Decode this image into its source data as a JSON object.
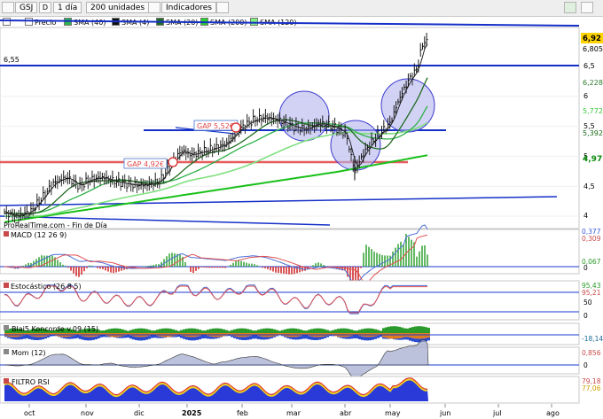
{
  "toolbar": {
    "symbol": "GSJ",
    "interval": "1 día",
    "units": "200 unidades",
    "indicators": "Indicadores"
  },
  "legend": {
    "price": "Precio",
    "items": [
      {
        "label": "SMA (40)",
        "color": "#2db34a"
      },
      {
        "label": "SMA (4)",
        "color": "#111111"
      },
      {
        "label": "SMA (20)",
        "color": "#1f6b1f"
      },
      {
        "label": "SMA (200)",
        "color": "#27d127"
      },
      {
        "label": "SMA (120)",
        "color": "#7ef07e"
      }
    ]
  },
  "main": {
    "level_label": "6,55",
    "source": "ProRealTime.com - Fin de Día",
    "gap_labels": [
      "GAP 4,92€",
      "GAP 5,52€"
    ],
    "y_ticks": [
      "6,5",
      "6",
      "5,5",
      "5",
      "4,5",
      "4"
    ],
    "price_badges": [
      {
        "text": "6,92",
        "bg": "#ffd400",
        "fg": "#000000"
      },
      {
        "text": "6,805",
        "bg": "#ffffff",
        "fg": "#000000"
      },
      {
        "text": "6,228",
        "bg": "#ffffff",
        "fg": "#2a7a2a"
      },
      {
        "text": "5,772",
        "bg": "#ffffff",
        "fg": "#37c837"
      },
      {
        "text": "5,392",
        "bg": "#ffffff",
        "fg": "#1a6a1a"
      },
      {
        "text": "4,97",
        "bg": "#ffffff",
        "fg": "#0b8a0b"
      }
    ]
  },
  "panels": {
    "macd": {
      "label": "MACD (12 26 9)",
      "values": [
        "0,377",
        "0,309",
        "0,067"
      ],
      "zero": "0"
    },
    "stoch": {
      "label": "Estocástico (26 8 5)",
      "values": [
        "95,43",
        "95,21"
      ],
      "ticks": [
        "50",
        "0"
      ]
    },
    "blai5": {
      "label": "Blai5 Koncorde v.09 (15)",
      "values": [
        "-18,14"
      ]
    },
    "mom": {
      "label": "Mom (12)",
      "values": [
        "0,856"
      ],
      "zero": "0"
    },
    "rsi": {
      "label": "FILTRO RSI",
      "values": [
        "79,18",
        "77,06"
      ]
    }
  },
  "x_axis": {
    "months": [
      "oct",
      "nov",
      "dic",
      "2025",
      "feb",
      "mar",
      "abr",
      "may",
      "jun",
      "jul",
      "ago"
    ]
  },
  "chart_data": {
    "type": "line",
    "series": [
      {
        "name": "Precio",
        "x": [
          "oct",
          "nov",
          "dic",
          "2025",
          "feb",
          "mar",
          "abr",
          "may"
        ],
        "values": [
          4.05,
          4.45,
          4.55,
          4.95,
          5.7,
          5.5,
          5.1,
          6.4
        ]
      },
      {
        "name": "SMA (200)",
        "x": [
          "oct",
          "nov",
          "dic",
          "2025",
          "feb",
          "mar",
          "abr",
          "may"
        ],
        "values": [
          4.1,
          4.3,
          4.45,
          4.55,
          4.75,
          4.85,
          4.9,
          4.97
        ]
      }
    ],
    "ylim": [
      3.9,
      7.0
    ],
    "last_price": 6.92
  }
}
